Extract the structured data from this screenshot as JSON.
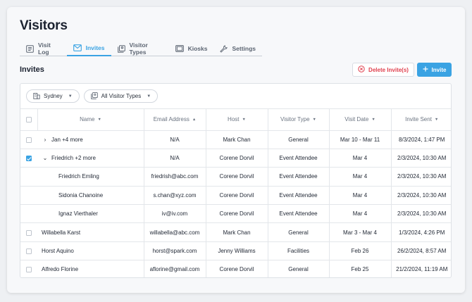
{
  "page": {
    "title": "Visitors"
  },
  "tabs": [
    {
      "label": "Visit Log",
      "icon": "visit-log-icon",
      "active": false
    },
    {
      "label": "Invites",
      "icon": "mail-icon",
      "active": true
    },
    {
      "label": "Visitor Types",
      "icon": "visitor-types-icon",
      "active": false
    },
    {
      "label": "Kiosks",
      "icon": "kiosk-icon",
      "active": false
    },
    {
      "label": "Settings",
      "icon": "wrench-icon",
      "active": false
    }
  ],
  "section": {
    "title": "Invites"
  },
  "actions": {
    "delete_label": "Delete Invite(s)",
    "invite_label": "Invite"
  },
  "filters": {
    "location": "Sydney",
    "visitor_type": "All Visitor Types"
  },
  "columns": [
    "Name",
    "Email Address",
    "Host",
    "Visitor Type",
    "Visit Date",
    "Invite Sent"
  ],
  "rows": [
    {
      "name": "Jan +4 more",
      "email": "N/A",
      "host": "Mark Chan",
      "type": "General",
      "date": "Mar 10 - Mar 11",
      "sent": "8/3/2024, 1:47 PM"
    },
    {
      "name": "Friedrich +2 more",
      "email": "N/A",
      "host": "Corene Dorvil",
      "type": "Event Attendee",
      "date": "Mar 4",
      "sent": "2/3/2024, 10:30 AM"
    },
    {
      "name": "Friedrich Emling",
      "email": "friedrish@abc.com",
      "host": "Corene Dorvil",
      "type": "Event Attendee",
      "date": "Mar 4",
      "sent": "2/3/2024, 10:30 AM"
    },
    {
      "name": "Sidonia Chanoine",
      "email": "s.chan@xyz.com",
      "host": "Corene Dorvil",
      "type": "Event Attendee",
      "date": "Mar 4",
      "sent": "2/3/2024, 10:30 AM"
    },
    {
      "name": "Ignaz Vierthaler",
      "email": "iv@iv.com",
      "host": "Corene Dorvil",
      "type": "Event Attendee",
      "date": "Mar 4",
      "sent": "2/3/2024, 10:30 AM"
    },
    {
      "name": "Willabella Karst",
      "email": "willabella@abc.com",
      "host": "Mark Chan",
      "type": "General",
      "date": "Mar 3 - Mar 4",
      "sent": "1/3/2024, 4:26 PM"
    },
    {
      "name": "Horst Aquino",
      "email": "horst@spark.com",
      "host": "Jenny Williams",
      "type": "Facilities",
      "date": "Feb 26",
      "sent": "26/2/2024, 8:57 AM"
    },
    {
      "name": "Alfredo Florine",
      "email": "aflorine@gmail.com",
      "host": "Corene Dorvil",
      "type": "General",
      "date": "Feb 25",
      "sent": "21/2/2024, 11:19 AM"
    }
  ],
  "colors": {
    "accent": "#3aa3e3",
    "danger": "#e0404e"
  }
}
